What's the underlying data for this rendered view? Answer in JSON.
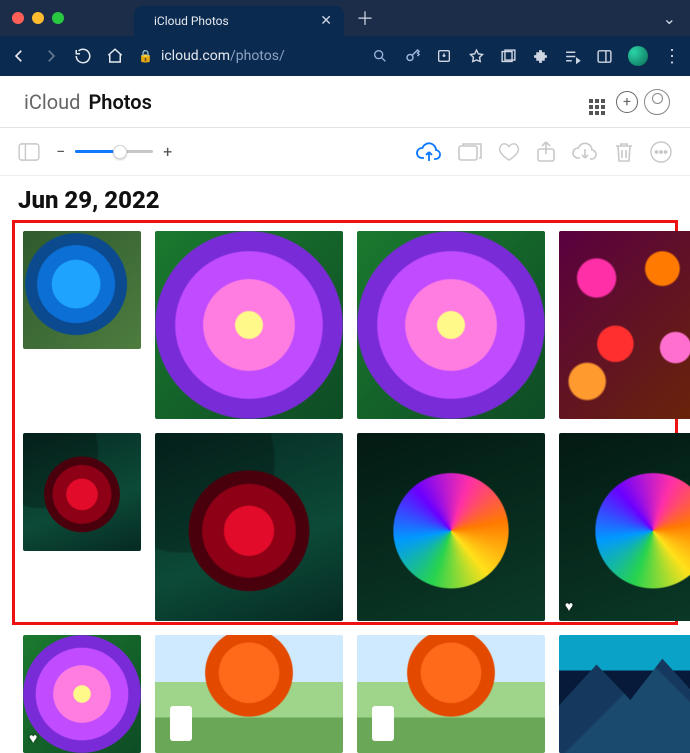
{
  "browser": {
    "tab_title": "iCloud Photos",
    "url_host": "icloud.com",
    "url_path": "/photos/"
  },
  "header": {
    "brand_prefix": "iCloud",
    "brand_main": "Photos"
  },
  "toolbar": {
    "zoom_minus": "−",
    "zoom_plus": "+",
    "zoom_percent": 58
  },
  "date_heading": "Jun 29, 2022",
  "photos": [
    {
      "id": "blue-rose",
      "shape": "sq",
      "fav": false,
      "kind": "blue-rose"
    },
    {
      "id": "dahlia-1",
      "shape": "sq",
      "fav": false,
      "kind": "dahlia"
    },
    {
      "id": "dahlia-2",
      "shape": "sq",
      "fav": false,
      "kind": "dahlia"
    },
    {
      "id": "mixed-1",
      "shape": "sq",
      "fav": false,
      "kind": "mixed"
    },
    {
      "id": "mixed-2",
      "shape": "sq",
      "fav": false,
      "kind": "mixed"
    },
    {
      "id": "red-rose-1",
      "shape": "sq",
      "fav": false,
      "kind": "red-rose"
    },
    {
      "id": "red-rose-2",
      "shape": "sq",
      "fav": false,
      "kind": "red-rose"
    },
    {
      "id": "rainbow-1",
      "shape": "sq",
      "fav": false,
      "kind": "rainbow"
    },
    {
      "id": "rainbow-2",
      "shape": "sq",
      "fav": true,
      "kind": "rainbow"
    },
    {
      "id": "dahlia-3",
      "shape": "sq",
      "fav": false,
      "kind": "dahlia-big"
    },
    {
      "id": "dahlia-4",
      "shape": "sq",
      "fav": true,
      "kind": "dahlia"
    },
    {
      "id": "autumn-1",
      "shape": "land",
      "fav": false,
      "kind": "autumn"
    },
    {
      "id": "autumn-2",
      "shape": "land",
      "fav": false,
      "kind": "autumn"
    },
    {
      "id": "mountain-1",
      "shape": "land",
      "fav": false,
      "kind": "mtn"
    },
    {
      "id": "mountain-2",
      "shape": "land",
      "fav": false,
      "kind": "mtn"
    }
  ]
}
